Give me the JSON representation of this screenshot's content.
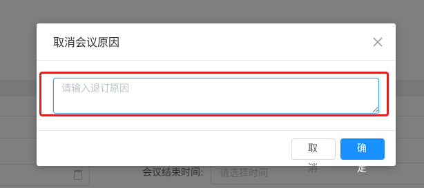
{
  "background": {
    "end_time_label": "会议结束时间:",
    "end_time_placeholder": "请选择时间"
  },
  "dialog": {
    "title": "取消会议原因",
    "reason_placeholder": "请输入退订原因",
    "reason_value": "",
    "cancel_label": "取 消",
    "confirm_label": "确 定"
  },
  "colors": {
    "primary": "#1890ff",
    "highlight": "#e02020",
    "overlay": "rgba(0,0,0,0.5)"
  },
  "icons": {
    "close": "close-icon",
    "calendar": "calendar-icon"
  }
}
